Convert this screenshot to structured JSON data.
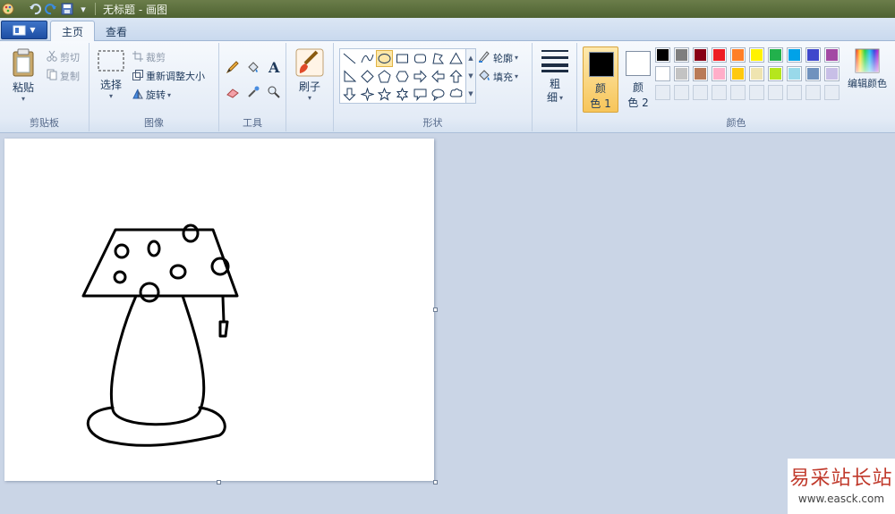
{
  "window": {
    "title": "无标题 - 画图"
  },
  "tabs": {
    "home": "主页",
    "view": "查看"
  },
  "clipboard": {
    "paste": "粘贴",
    "cut": "剪切",
    "copy": "复制",
    "label": "剪贴板"
  },
  "image": {
    "select": "选择",
    "crop": "裁剪",
    "resize": "重新调整大小",
    "rotate": "旋转",
    "label": "图像"
  },
  "tools": {
    "label": "工具"
  },
  "brushes": {
    "label": "刷子"
  },
  "shapes": {
    "outline": "轮廓",
    "fill": "填充",
    "label": "形状",
    "selected": "oval"
  },
  "size": {
    "label_line1": "粗",
    "label_line2": "细"
  },
  "colors": {
    "color1_line1": "颜",
    "color1_line2": "色 1",
    "color2_line1": "颜",
    "color2_line2": "色 2",
    "edit": "编辑颜色",
    "label": "颜色",
    "color1_value": "#000000",
    "color2_value": "#ffffff",
    "palette_row1": [
      "#000000",
      "#7f7f7f",
      "#880015",
      "#ed1c24",
      "#ff7f27",
      "#fff200",
      "#22b14c",
      "#00a2e8",
      "#3f48cc",
      "#a349a4"
    ],
    "palette_row2": [
      "#ffffff",
      "#c3c3c3",
      "#b97a57",
      "#ffaec9",
      "#ffc90e",
      "#efe4b0",
      "#b5e61d",
      "#99d9ea",
      "#7092be",
      "#c8bfe7"
    ]
  },
  "watermark": {
    "name": "易采站长站",
    "url": "www.easck.com"
  }
}
